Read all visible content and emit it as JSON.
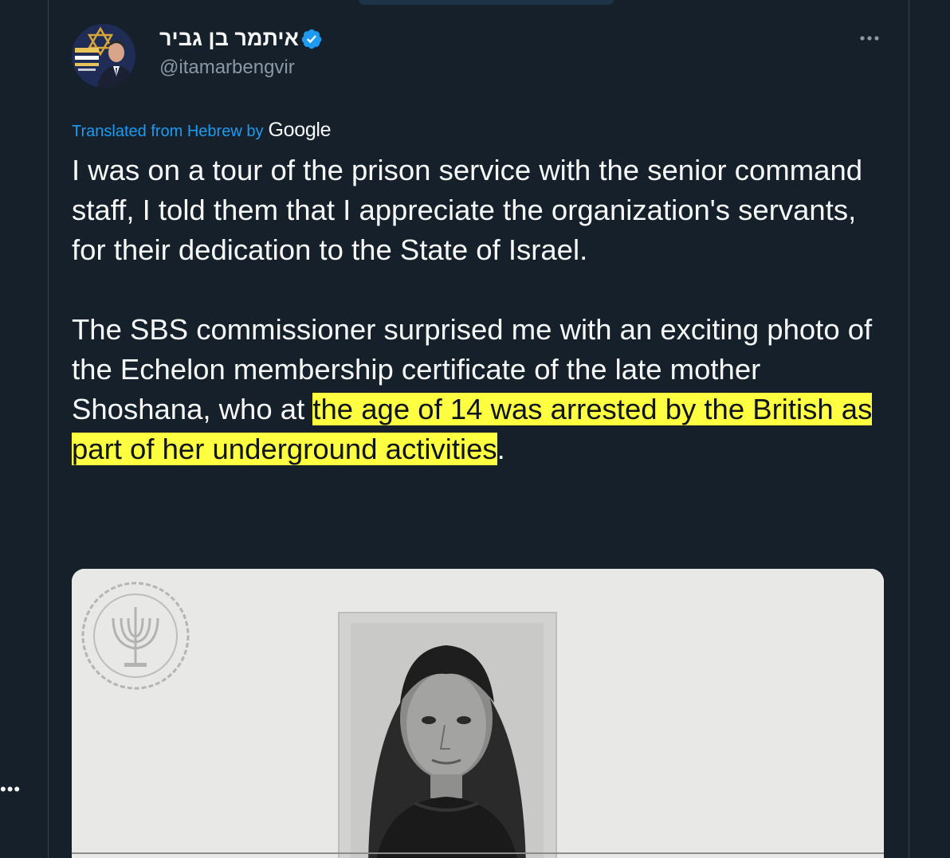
{
  "author": {
    "name": "איתמר בן גביר",
    "handle": "@itamarbengvir"
  },
  "translation": {
    "label": "Translated from Hebrew by",
    "provider": "Google"
  },
  "tweet": {
    "paragraph1": "I was on a tour of the prison service with the senior command staff, I told them that I appreciate the organization's servants, for their dedication to the State of Israel.",
    "paragraph2_start": "The SBS commissioner surprised me with an exciting photo of the Echelon membership certificate of the late mother Shoshana, who at ",
    "paragraph2_highlight": "the age of 14 was arrested by the British as part of her underground activities",
    "paragraph2_end": "."
  },
  "icons": {
    "verified": "verified-badge-icon",
    "more": "more-options-icon"
  },
  "colors": {
    "background": "#15202b",
    "accent": "#1d9bf0",
    "highlight": "#ffff41",
    "text": "#f7f9f9",
    "secondary_text": "#8b98a5"
  }
}
